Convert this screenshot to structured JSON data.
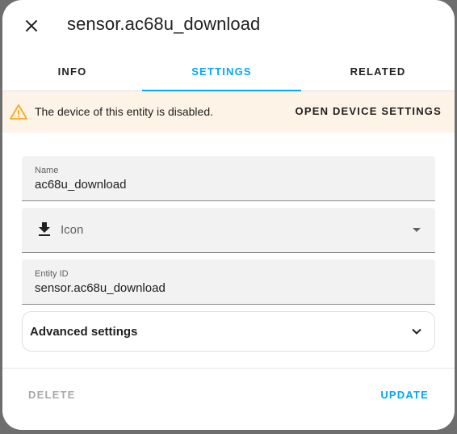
{
  "dialog": {
    "title": "sensor.ac68u_download",
    "close_icon": "close-icon"
  },
  "tabs": [
    {
      "label": "Info",
      "active": false
    },
    {
      "label": "Settings",
      "active": true
    },
    {
      "label": "Related",
      "active": false
    }
  ],
  "warning": {
    "icon": "warning-triangle-icon",
    "text": "The device of this entity is disabled.",
    "action_label": "OPEN DEVICE SETTINGS",
    "color": "#f9a825"
  },
  "form": {
    "name": {
      "label": "Name",
      "value": "ac68u_download"
    },
    "icon": {
      "prefix_icon": "download-icon",
      "placeholder": "Icon"
    },
    "entity_id": {
      "label": "Entity ID",
      "value": "sensor.ac68u_download"
    },
    "advanced": {
      "label": "Advanced settings",
      "icon": "chevron-down-icon"
    }
  },
  "actions": {
    "delete_label": "DELETE",
    "update_label": "UPDATE"
  },
  "colors": {
    "accent": "#03a9f4",
    "warning_bg": "#fdf3e6",
    "field_bg": "#f2f2f2"
  }
}
